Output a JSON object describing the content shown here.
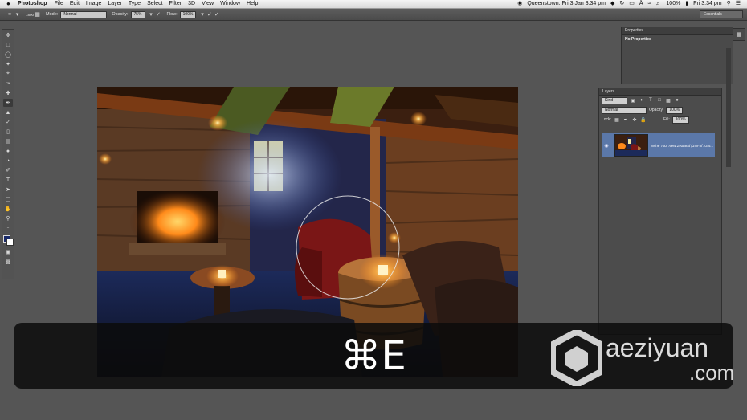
{
  "menubar": {
    "app_name": "Photoshop",
    "menus": [
      "File",
      "Edit",
      "Image",
      "Layer",
      "Type",
      "Select",
      "Filter",
      "3D",
      "View",
      "Window",
      "Help"
    ],
    "location_time": "Queenstown: Fri 3 Jan  3:34 pm",
    "battery": "100%",
    "clock": "Fri 3:34 pm"
  },
  "options_bar": {
    "brush_size": "1800",
    "mode_label": "Mode:",
    "mode_value": "Normal",
    "opacity_label": "Opacity:",
    "opacity_value": "75%",
    "flow_label": "Flow:",
    "flow_value": "100%",
    "workspace": "Essentials"
  },
  "properties_panel": {
    "tab": "Properties",
    "content": "No Properties"
  },
  "layers_panel": {
    "tab": "Layers",
    "kind_filter": "Kind",
    "blend_mode": "Normal",
    "opacity_label": "Opacity:",
    "opacity_value": "100%",
    "lock_label": "Lock:",
    "fill_label": "Fill:",
    "fill_value": "100%",
    "layer_name": "Wine Tour New Zealand (159 of 23.5..."
  },
  "overlay": {
    "shortcut": "⌘E",
    "watermark": "aeziyuan",
    "watermark_sub": ".com"
  },
  "colors": {
    "foreground": "#1a2b6a",
    "background": "#ffffff",
    "selected_layer": "#5b78a9"
  }
}
